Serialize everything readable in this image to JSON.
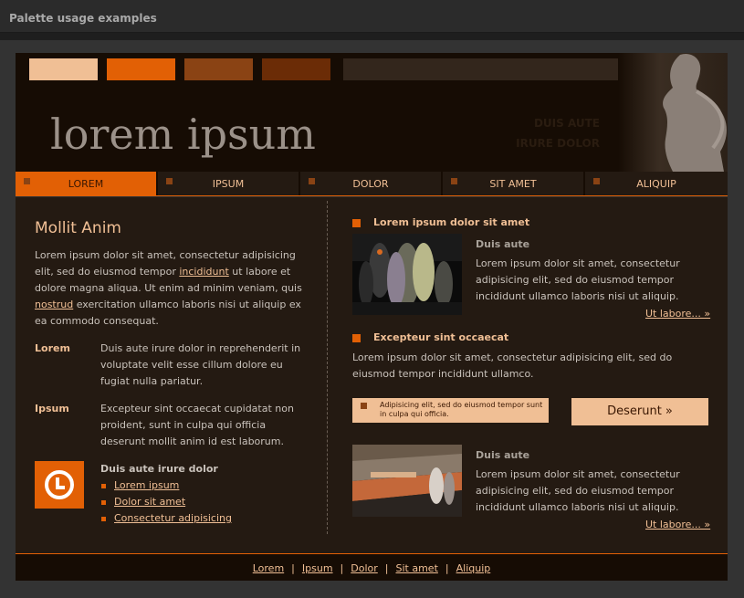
{
  "window": {
    "title": "Palette usage examples"
  },
  "colors": {
    "light": "#f0bf95",
    "orange": "#e26005",
    "brown": "#8a4314",
    "dark_brown": "#6b2c06",
    "bg": "#241a12"
  },
  "header": {
    "logo": "lorem ipsum",
    "slogan_line1": "DUIS AUTE",
    "slogan_line2": "IRURE DOLOR"
  },
  "nav": {
    "items": [
      "LOREM",
      "IPSUM",
      "DOLOR",
      "SIT AMET",
      "ALIQUIP"
    ]
  },
  "left": {
    "heading": "Mollit Anim",
    "intro_a": "Lorem ipsum dolor sit amet, consectetur adipisicing elit, sed do eiusmod tempor",
    "intro_link1": "incididunt",
    "intro_b": "ut labore et dolore magna aliqua. Ut enim ad minim veniam, quis",
    "intro_link2": "nostrud",
    "intro_c": "exercitation ullamco laboris nisi ut aliquip ex ea commodo consequat.",
    "term1": "Lorem",
    "def1": "Duis aute irure dolor in reprehenderit in voluptate velit esse cillum dolore eu fugiat nulla pariatur.",
    "term2": "Ipsum",
    "def2": "Excepteur sint occaecat cupidatat non proident, sunt in culpa qui officia deserunt mollit anim id est laborum.",
    "list_title": "Duis aute irure dolor",
    "list": [
      "Lorem ipsum",
      "Dolor sit amet",
      "Consectetur adipisicing"
    ]
  },
  "right": {
    "section1_title": "Lorem ipsum dolor sit amet",
    "block1_subtitle": "Duis aute",
    "block1_text": "Lorem ipsum dolor sit amet, consectetur adipisicing elit, sed do eiusmod tempor incididunt ullamco laboris nisi ut aliquip.",
    "more1": "Ut labore... »",
    "section2_title": "Excepteur sint occaecat",
    "section2_text": "Lorem ipsum dolor sit amet, consectetur adipisicing elit, sed do eiusmod tempor incididunt ullamco.",
    "note": "Adipisicing elit, sed do eiusmod tempor sunt in culpa qui officia.",
    "button": "Deserunt »",
    "block2_subtitle": "Duis aute",
    "block2_text": "Lorem ipsum dolor sit amet, consectetur adipisicing elit, sed do eiusmod tempor incididunt ullamco laboris nisi ut aliquip.",
    "more2": "Ut labore... »"
  },
  "footer": {
    "links": [
      "Lorem",
      "Ipsum",
      "Dolor",
      "Sit amet",
      "Aliquip"
    ]
  }
}
